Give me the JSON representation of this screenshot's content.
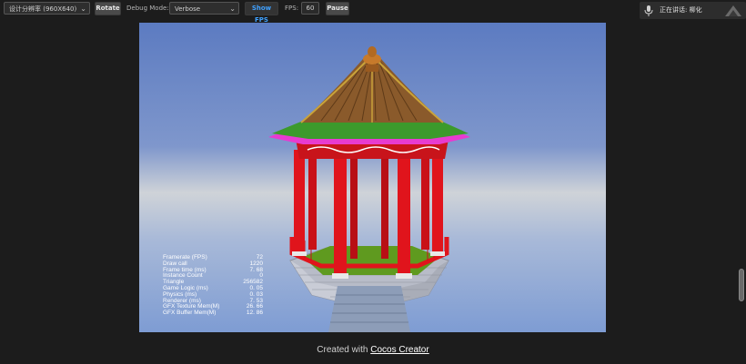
{
  "toolbar": {
    "resolution_select": "设计分辨率 (960X640)",
    "rotate_label": "Rotate",
    "debug_mode_label": "Debug Mode:",
    "debug_mode_value": "Verbose",
    "show_fps_label": "Show FPS",
    "fps_label": "FPS:",
    "fps_value": "60",
    "pause_label": "Pause"
  },
  "notification": {
    "text": "正在讲话: 柳化"
  },
  "stats": [
    {
      "label": "Framerate (FPS)",
      "value": "72"
    },
    {
      "label": "Draw call",
      "value": "1220"
    },
    {
      "label": "Frame time (ms)",
      "value": "7. 68"
    },
    {
      "label": "Instance Count",
      "value": "0"
    },
    {
      "label": "Triangle",
      "value": "256582"
    },
    {
      "label": "Game Logic (ms)",
      "value": "0. 05"
    },
    {
      "label": "Physics (ms)",
      "value": "0. 03"
    },
    {
      "label": "Renderer (ms)",
      "value": "7. 53"
    },
    {
      "label": "GFX Texture Mem(M)",
      "value": "26. 66"
    },
    {
      "label": "GFX Buffer Mem(M)",
      "value": "12. 86"
    }
  ],
  "footer": {
    "prefix": "Created with ",
    "link": "Cocos Creator"
  },
  "colors": {
    "accent": "#3fa1ff",
    "pillar_red": "#e0141c",
    "roof_brown": "#8a5a2b"
  }
}
